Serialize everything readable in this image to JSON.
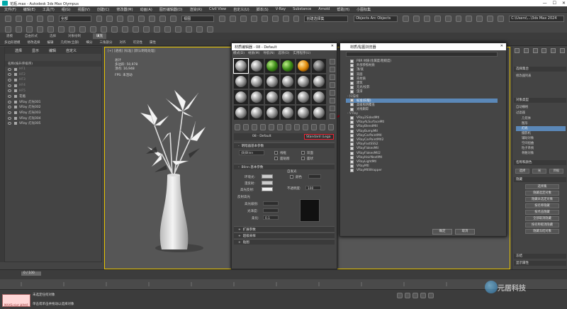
{
  "window": {
    "title": "花瓶.max - Autodesk 3ds Max Olympus"
  },
  "menubar": [
    "文件(F)",
    "编辑(E)",
    "工具(T)",
    "组(G)",
    "视图(V)",
    "创建(C)",
    "修改器(M)",
    "动画(A)",
    "图形编辑器(D)",
    "渲染(R)",
    "Civil View",
    "自定义(U)",
    "脚本(S)",
    "V-Ray",
    "Substance",
    "Arnold",
    "帮助(H)",
    "小图标集"
  ],
  "toolbar": {
    "filter": "全部",
    "view": "视图",
    "selection_set": "创建选择集",
    "objects": "Objects Arc Objects",
    "path": "C:\\Users\\...\\3ds Max 2024"
  },
  "tabs": [
    {
      "label": "建模"
    },
    {
      "label": "自由形式"
    },
    {
      "label": "选择"
    },
    {
      "label": "对象绘制"
    },
    {
      "label": "填充",
      "active": true
    }
  ],
  "ribbon2": [
    "多边形建模",
    "修改选择",
    "编辑",
    "几何体(全部)",
    "细分",
    "三角剖分",
    "对齐",
    "可见性",
    "属性"
  ],
  "explorer": {
    "tabs": [
      "选择",
      "显示",
      "编辑",
      "自定义"
    ],
    "header": "名称(按升序排序)",
    "rows": [
      {
        "name": "HF1",
        "dim": true
      },
      {
        "name": "HF2",
        "dim": true
      },
      {
        "name": "HF3",
        "dim": true
      },
      {
        "name": "HF4",
        "dim": true
      },
      {
        "name": "HF5",
        "dim": true
      },
      {
        "name": "花瓶",
        "dim": false
      },
      {
        "name": "VRay 灯光001",
        "dim": false
      },
      {
        "name": "VRay 灯光002",
        "dim": false
      },
      {
        "name": "VRay 灯光003",
        "dim": false
      },
      {
        "name": "VRay 灯光004",
        "dim": false
      },
      {
        "name": "VRay 灯光005",
        "dim": false
      }
    ]
  },
  "viewport": {
    "label": "[+] [透视] [标准] [默认明暗处理]",
    "stats": {
      "total": "总计",
      "polys_label": "多边形:",
      "polys": "50,978",
      "verts_label": "顶点:",
      "verts": "16,948",
      "fps_label": "FPS:",
      "fps": "未活动"
    }
  },
  "material_editor": {
    "title": "材质编辑器 - 08 - Default",
    "menu": [
      "模式(D)",
      "材质(M)",
      "导航(N)",
      "选项(O)",
      "实用程序(U)"
    ],
    "material_name": "08 - Default",
    "type_button": "Standard (Lega",
    "rollouts": {
      "shader": "明暗器基本参数",
      "blinn": "Blinn 基本参数",
      "extended": "扩展参数",
      "supersampling": "超级采样",
      "maps": "贴图"
    },
    "shader_type": "(B)Blinn",
    "shader_opts": [
      "线框",
      "双面",
      "面贴图",
      "面状"
    ],
    "fields": {
      "ambient": "环境光:",
      "diffuse": "漫反射:",
      "specular": "高光反射:",
      "self_illum": "自发光",
      "color": "颜色",
      "opacity": "不透明度:",
      "opacity_value": "100",
      "spec_highlights": "反射高光",
      "spec_level": "高光级别:",
      "glossiness": "光泽度:",
      "soften": "柔化:",
      "soften_value": "0.1"
    }
  },
  "browser": {
    "title": "材质/贴图浏览器",
    "items": [
      {
        "label": "PBR 材质(金属度/粗糙度)",
        "type": "item"
      },
      {
        "label": "外部参照材质",
        "type": "item"
      },
      {
        "label": "顶/底",
        "type": "item"
      },
      {
        "label": "双面",
        "type": "item"
      },
      {
        "label": "壳材质",
        "type": "item"
      },
      {
        "label": "建筑",
        "type": "item"
      },
      {
        "label": "无光/投影",
        "type": "item"
      },
      {
        "label": "虫漆",
        "type": "item"
      },
      {
        "label": "- 扫描线",
        "type": "group"
      },
      {
        "label": "标准(旧版)",
        "type": "selected"
      },
      {
        "label": "高级照明覆盖",
        "type": "item"
      },
      {
        "label": "光线跟踪",
        "type": "item"
      },
      {
        "label": "- V-Ray",
        "type": "group"
      },
      {
        "label": "VRay2SidedMtl",
        "type": "item"
      },
      {
        "label": "VRayALSurfaceMtl",
        "type": "item"
      },
      {
        "label": "VRayBlendMtl",
        "type": "item"
      },
      {
        "label": "VRayBumpMtl",
        "type": "item"
      },
      {
        "label": "VRayCarPaintMtl",
        "type": "item"
      },
      {
        "label": "VRayCarPaintMtl2",
        "type": "item"
      },
      {
        "label": "VRayFastSSS2",
        "type": "item"
      },
      {
        "label": "VRayFlakesMtl",
        "type": "item"
      },
      {
        "label": "VRayFlakesMtl2",
        "type": "item"
      },
      {
        "label": "VRayHairNextMtl",
        "type": "item"
      },
      {
        "label": "VRayLightMtl",
        "type": "item"
      },
      {
        "label": "VRayMtl",
        "type": "item"
      },
      {
        "label": "VRayMtlWrapper",
        "type": "item"
      }
    ],
    "ok": "确定",
    "cancel": "取消"
  },
  "command_panel": {
    "section1": "选择集合",
    "sec2": "修改器列表",
    "filter": "过滤器",
    "objects": {
      "header": "对象类型",
      "autogrid": "自动栅格",
      "items": [
        "几何体",
        "图形",
        "灯光",
        "摄影机",
        "辅助对象",
        "空间扭曲",
        "粒子系统",
        "骨骼对象"
      ]
    },
    "name_color": "名称和颜色",
    "buttons": {
      "btn1": "选择",
      "btn2": "光",
      "btn3": "目标",
      "sel1": "选择集",
      "sel2": "选择区域",
      "hide": "隐藏",
      "b_hide_sel": "隐藏选定对象",
      "b_hide_unsel": "隐藏未选定对象",
      "b_hide_name": "按名称隐藏",
      "b_hide_click": "按点击隐藏",
      "b_unhide_all": "全部取消隐藏",
      "b_unhide_name": "按名称取消隐藏",
      "b_hide_frozen": "隐藏冻结对象",
      "freeze": "冻结",
      "display": "显示属性"
    }
  },
  "timeline": {
    "frame": "0 / 100"
  },
  "status": {
    "line1": "未选定任何对象",
    "line2": "单击或单击并拖动以选择对象",
    "maxscript": "MAXScript 迷你侦听器"
  },
  "watermark": "元居科技"
}
